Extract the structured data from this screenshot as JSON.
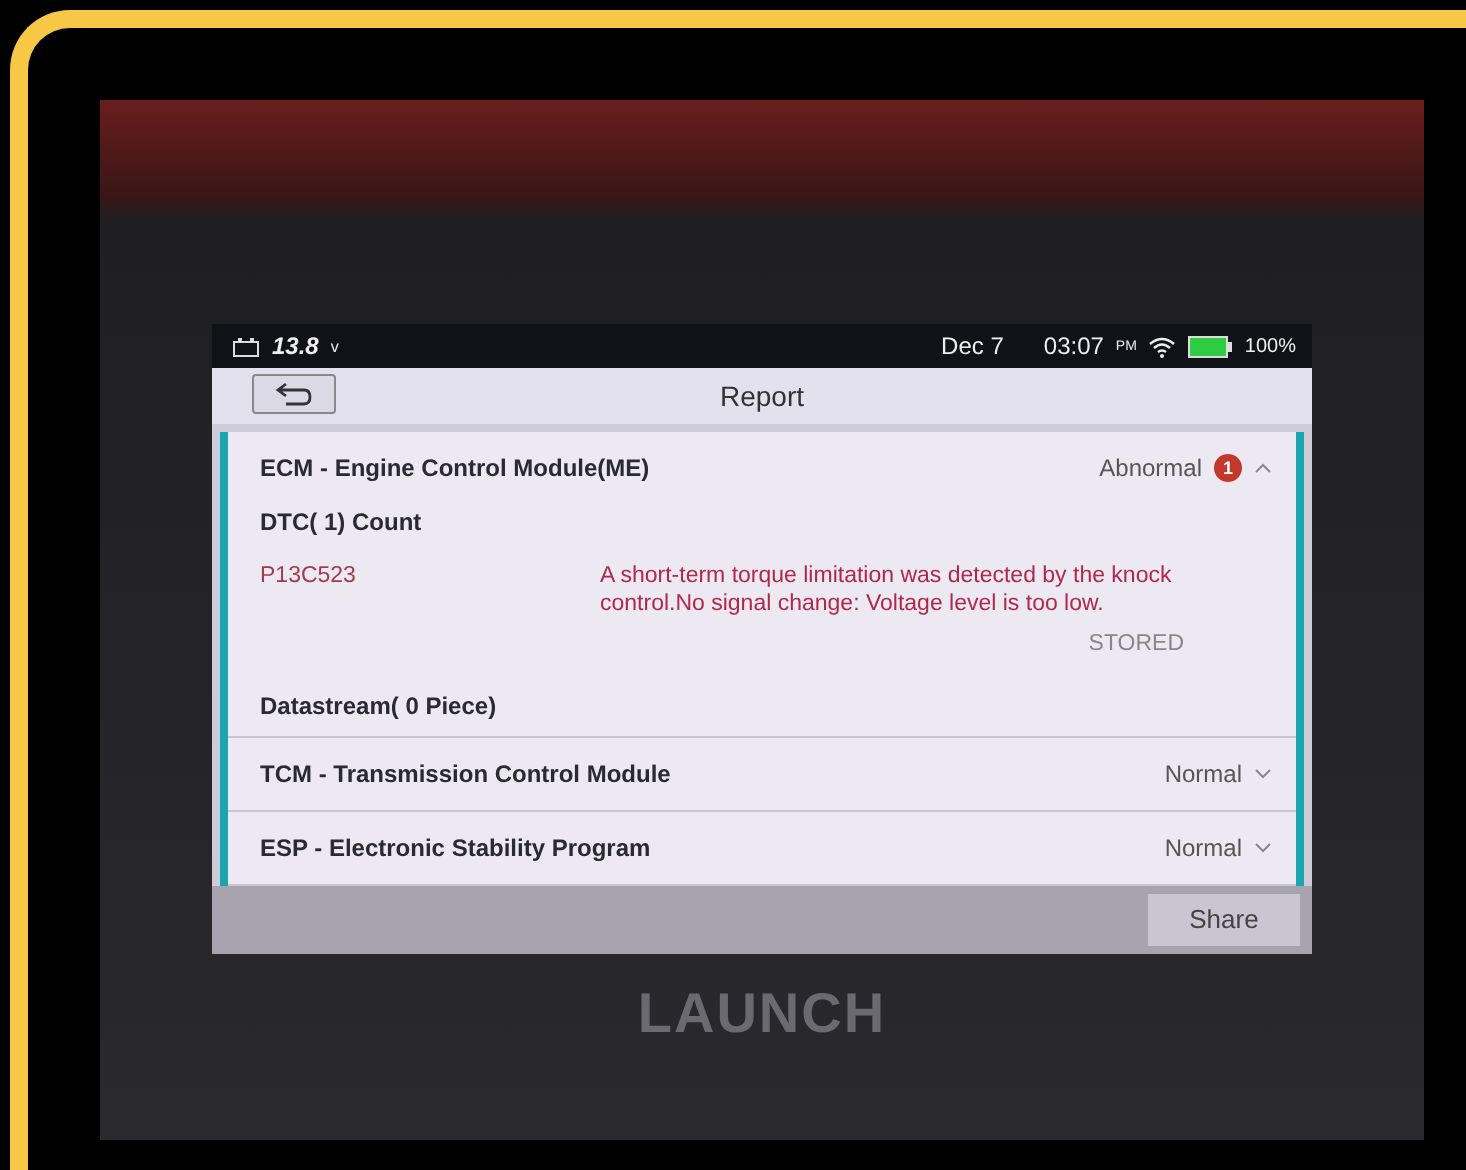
{
  "status_bar": {
    "voltage": "13.8",
    "voltage_unit": "v",
    "date": "Dec 7",
    "time": "03:07",
    "time_suffix": "PM",
    "battery": "100%"
  },
  "header": {
    "title": "Report"
  },
  "modules": [
    {
      "name": "ECM - Engine Control Module(ME)",
      "status": "Abnormal",
      "badge": "1",
      "expanded": true,
      "dtc_count": "DTC( 1) Count",
      "dtcs": [
        {
          "code": "P13C523",
          "description": "A short-term torque limitation was detected by the knock control.No signal change: Voltage level is too low.",
          "state": "STORED"
        }
      ],
      "datastream": "Datastream( 0 Piece)"
    },
    {
      "name": "TCM - Transmission Control Module",
      "status": "Normal",
      "expanded": false
    },
    {
      "name": "ESP - Electronic Stability Program",
      "status": "Normal",
      "expanded": false
    }
  ],
  "footer": {
    "button": "Share"
  },
  "device_brand": "LAUNCH"
}
